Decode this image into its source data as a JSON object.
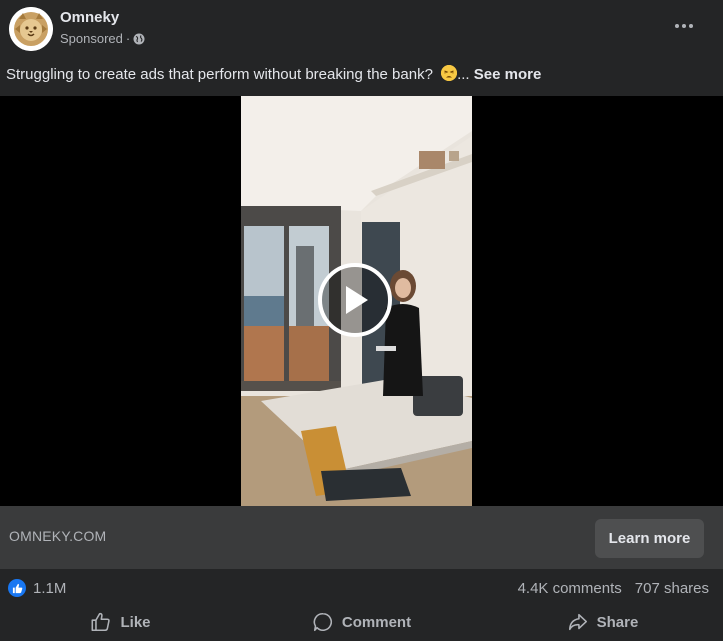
{
  "post": {
    "page_name": "Omneky",
    "sponsored_label": "Sponsored",
    "meta_separator": "·",
    "caption_text": "Struggling to create ads that perform without breaking the bank?",
    "caption_ellipsis": "...",
    "see_more_label": "See more",
    "emoji_icon": "tired-face-emoji"
  },
  "video": {
    "play_icon": "play-icon"
  },
  "link": {
    "domain": "OMNEKY.COM",
    "cta_label": "Learn more"
  },
  "engagement": {
    "reaction_count": "1.1M",
    "comments": "4.4K comments",
    "shares": "707 shares"
  },
  "actions": {
    "like_label": "Like",
    "comment_label": "Comment",
    "share_label": "Share"
  },
  "colors": {
    "background": "#242526",
    "link_bar": "#3a3b3c",
    "button": "#4e4f50",
    "like_blue": "#1877f2",
    "text_primary": "#e4e6eb",
    "text_secondary": "#b0b3b8"
  }
}
